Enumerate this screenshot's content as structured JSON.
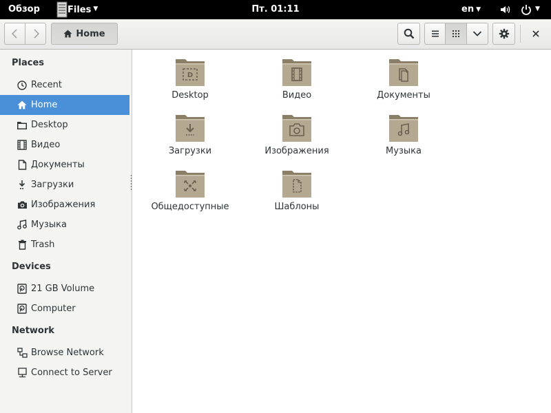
{
  "topbar": {
    "activities": "Обзор",
    "app_name": "Files",
    "clock": "Пт. 01:11",
    "language": "en"
  },
  "headerbar": {
    "path_button": "Home"
  },
  "icons": {
    "back": "go-previous-icon",
    "forward": "go-next-icon",
    "search": "search-icon",
    "list_view": "view-list-icon",
    "grid_view": "view-grid-icon",
    "view_menu": "chevron-down-icon",
    "settings": "gear-icon",
    "close": "close-icon"
  },
  "sidebar": {
    "places_title": "Places",
    "places": [
      {
        "label": "Recent",
        "icon": "clock-icon"
      },
      {
        "label": "Home",
        "icon": "home-icon",
        "selected": true
      },
      {
        "label": "Desktop",
        "icon": "folder-icon"
      },
      {
        "label": "Видео",
        "icon": "film-icon"
      },
      {
        "label": "Документы",
        "icon": "document-icon"
      },
      {
        "label": "Загрузки",
        "icon": "download-icon"
      },
      {
        "label": "Изображения",
        "icon": "camera-icon"
      },
      {
        "label": "Музыка",
        "icon": "music-icon"
      },
      {
        "label": "Trash",
        "icon": "trash-icon"
      }
    ],
    "devices_title": "Devices",
    "devices": [
      {
        "label": "21 GB Volume",
        "icon": "drive-icon"
      },
      {
        "label": "Computer",
        "icon": "drive-icon"
      }
    ],
    "network_title": "Network",
    "network": [
      {
        "label": "Browse Network",
        "icon": "network-icon"
      },
      {
        "label": "Connect to Server",
        "icon": "server-icon"
      }
    ]
  },
  "folders": [
    {
      "label": "Desktop",
      "emblem": "desktop"
    },
    {
      "label": "Видео",
      "emblem": "video"
    },
    {
      "label": "Документы",
      "emblem": "documents"
    },
    {
      "label": "Загрузки",
      "emblem": "downloads"
    },
    {
      "label": "Изображения",
      "emblem": "pictures"
    },
    {
      "label": "Музыка",
      "emblem": "music"
    },
    {
      "label": "Общедоступные",
      "emblem": "public"
    },
    {
      "label": "Шаблоны",
      "emblem": "templates"
    }
  ],
  "colors": {
    "selection": "#4a90d9",
    "folder": "#b4a891",
    "folder_dark": "#8c7f68",
    "topbar": "#000000"
  }
}
